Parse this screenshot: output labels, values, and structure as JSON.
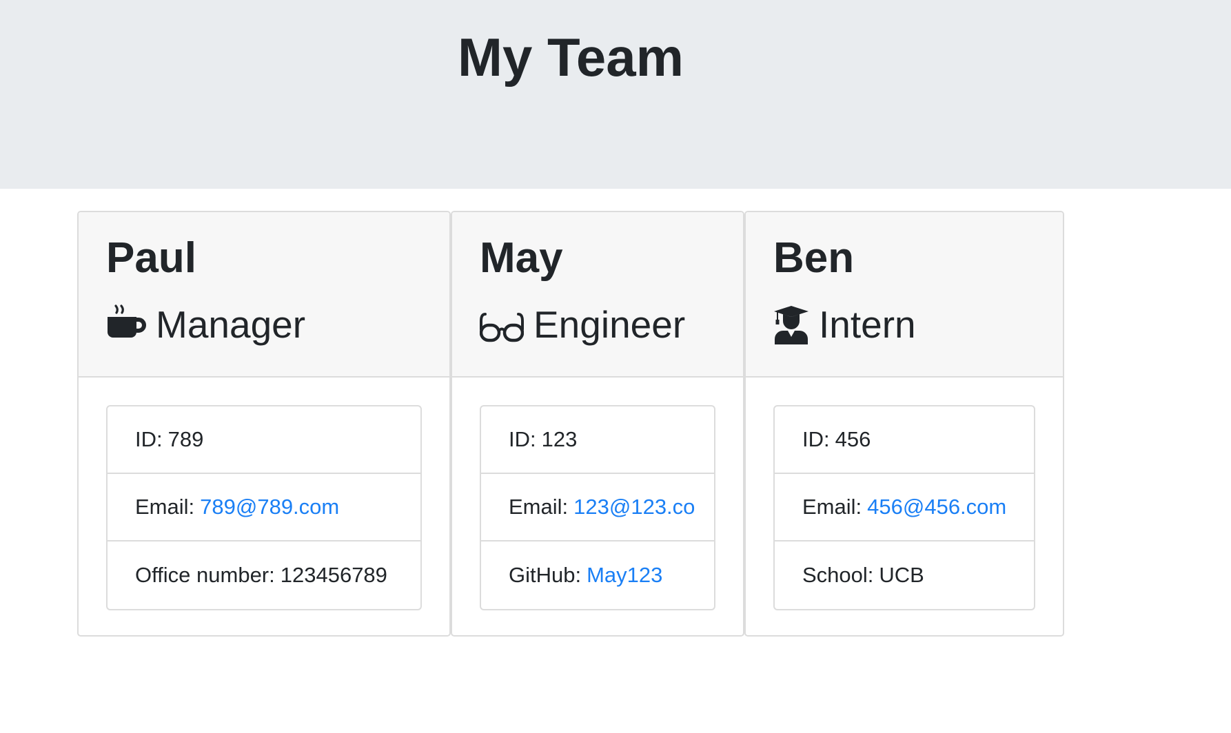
{
  "header": {
    "title": "My Team"
  },
  "cards": [
    {
      "name": "Paul",
      "role": "Manager",
      "role_icon": "coffee-mug-icon",
      "id_label": "ID:",
      "id": "789",
      "email_label": "Email:",
      "email": "789@789.com",
      "extra_label": "Office number:",
      "extra_value": "123456789"
    },
    {
      "name": "May",
      "role": "Engineer",
      "role_icon": "glasses-icon",
      "id_label": "ID:",
      "id": "123",
      "email_label": "Email:",
      "email": "123@123.co",
      "extra_label": "GitHub:",
      "extra_value": "May123"
    },
    {
      "name": "Ben",
      "role": "Intern",
      "role_icon": "graduate-icon",
      "id_label": "ID:",
      "id": "456",
      "email_label": "Email:",
      "email": "456@456.com",
      "extra_label": "School:",
      "extra_value": "UCB"
    }
  ],
  "colors": {
    "header_bg": "#e9ecef",
    "card_header_bg": "#f7f7f7",
    "link": "#1a7ff5",
    "text": "#212529"
  }
}
